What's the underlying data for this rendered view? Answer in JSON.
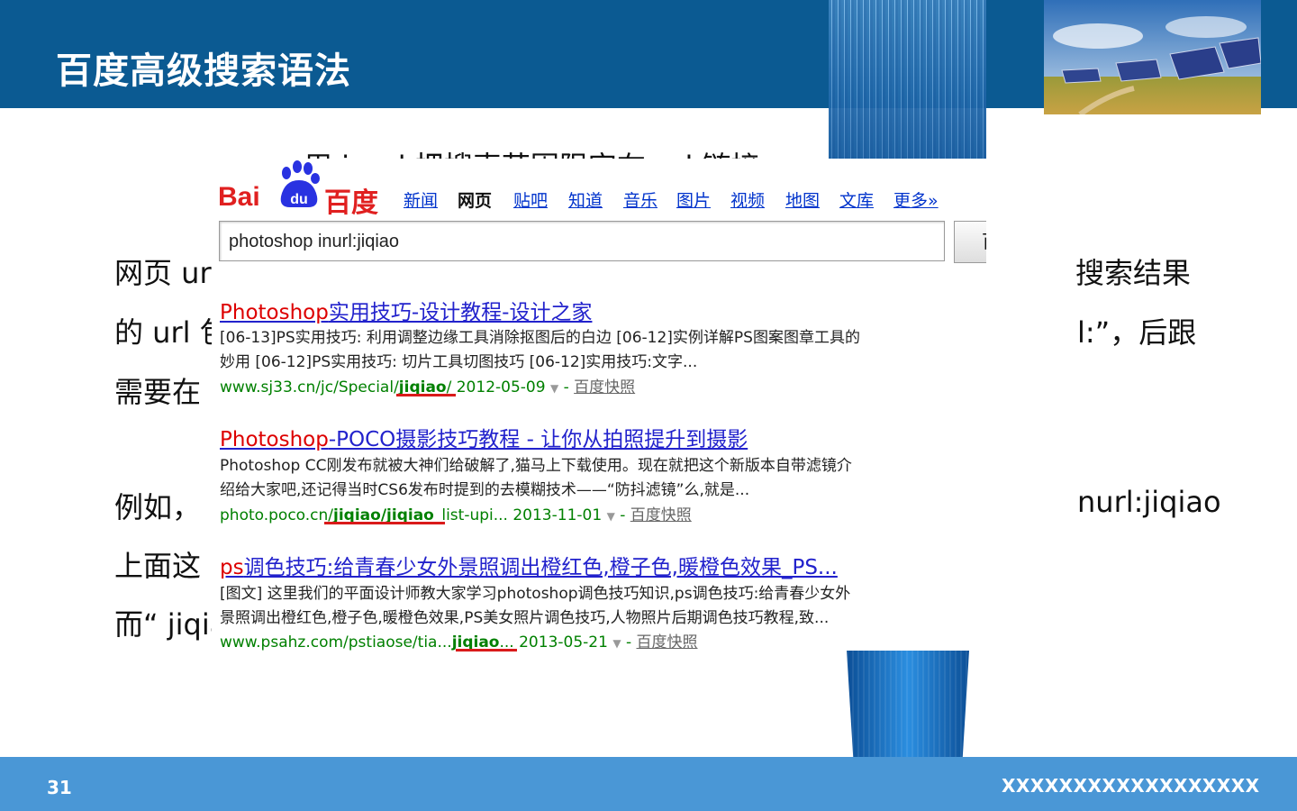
{
  "slide": {
    "title": "百度高级搜索语法",
    "page_number": "31",
    "footer_text": "XXXXXXXXXXXXXXXXXX",
    "body_lines": [
      "网页 ur",
      "搜索结果",
      "的 url 包",
      "l:”，后跟",
      "需要在",
      "例如，",
      "nurl:jiqiao",
      "上面这",
      "而“ jiqia"
    ],
    "cut_heading": "用 inurl 把搜索范围限定在 url 链接"
  },
  "baidu": {
    "logo_bai": "Bai",
    "logo_du": "du",
    "logo_cn": "百度",
    "nav": [
      "新闻",
      "网页",
      "贴吧",
      "知道",
      "音乐",
      "图片",
      "视频",
      "地图",
      "文库",
      "更多»"
    ],
    "query": "photoshop inurl:jiqiao",
    "search_button": "百度一下",
    "results": [
      {
        "title_hl": "Photoshop",
        "title_rest": "实用技巧-设计教程-设计之家",
        "snip1": "[06-13]PS实用技巧: 利用调整边缘工具消除抠图后的白边 [06-12]实例详解PS图案图章工具的",
        "snip2": "妙用 [06-12]PS实用技巧: 切片工具切图技巧 [06-12]实用技巧:文字...",
        "url_pre": "www.sj33.cn/jc/Special/",
        "url_bold": "jiqiao",
        "url_post": "/ 2012-05-09",
        "snapshot": "百度快照"
      },
      {
        "title_hl": "Photoshop",
        "title_rest": "-POCO摄影技巧教程 - 让你从拍照提升到摄影",
        "snip1": "Photoshop CC刚发布就被大神们给破解了,猫马上下载使用。现在就把这个新版本自带滤镜介",
        "snip2": "绍给大家吧,还记得当时CS6发布时提到的去模糊技术——“防抖滤镜”么,就是...",
        "url_pre": "photo.poco.cn/",
        "url_bold": "jiqiao/jiqiao",
        "url_post": "_list-upi... 2013-11-01",
        "snapshot": "百度快照"
      },
      {
        "title_hl": "ps",
        "title_rest": "调色技巧:给青春少女外景照调出橙红色,橙子色,暖橙色效果_PS...",
        "snip1": "[图文] 这里我们的平面设计师教大家学习photoshop调色技巧知识,ps调色技巧:给青春少女外",
        "snip2": "景照调出橙红色,橙子色,暖橙色效果,PS美女照片调色技巧,人物照片后期调色技巧教程,致...",
        "url_pre": "www.psahz.com/pstiaose/tia...",
        "url_bold": "jiqiao",
        "url_post": "... 2013-05-21",
        "snapshot": "百度快照"
      }
    ]
  },
  "colors": {
    "top_bar": "#0b5a92",
    "bottom_bar": "#4a97d6",
    "baidu_red": "#e02020",
    "link_blue": "#2222cc"
  }
}
